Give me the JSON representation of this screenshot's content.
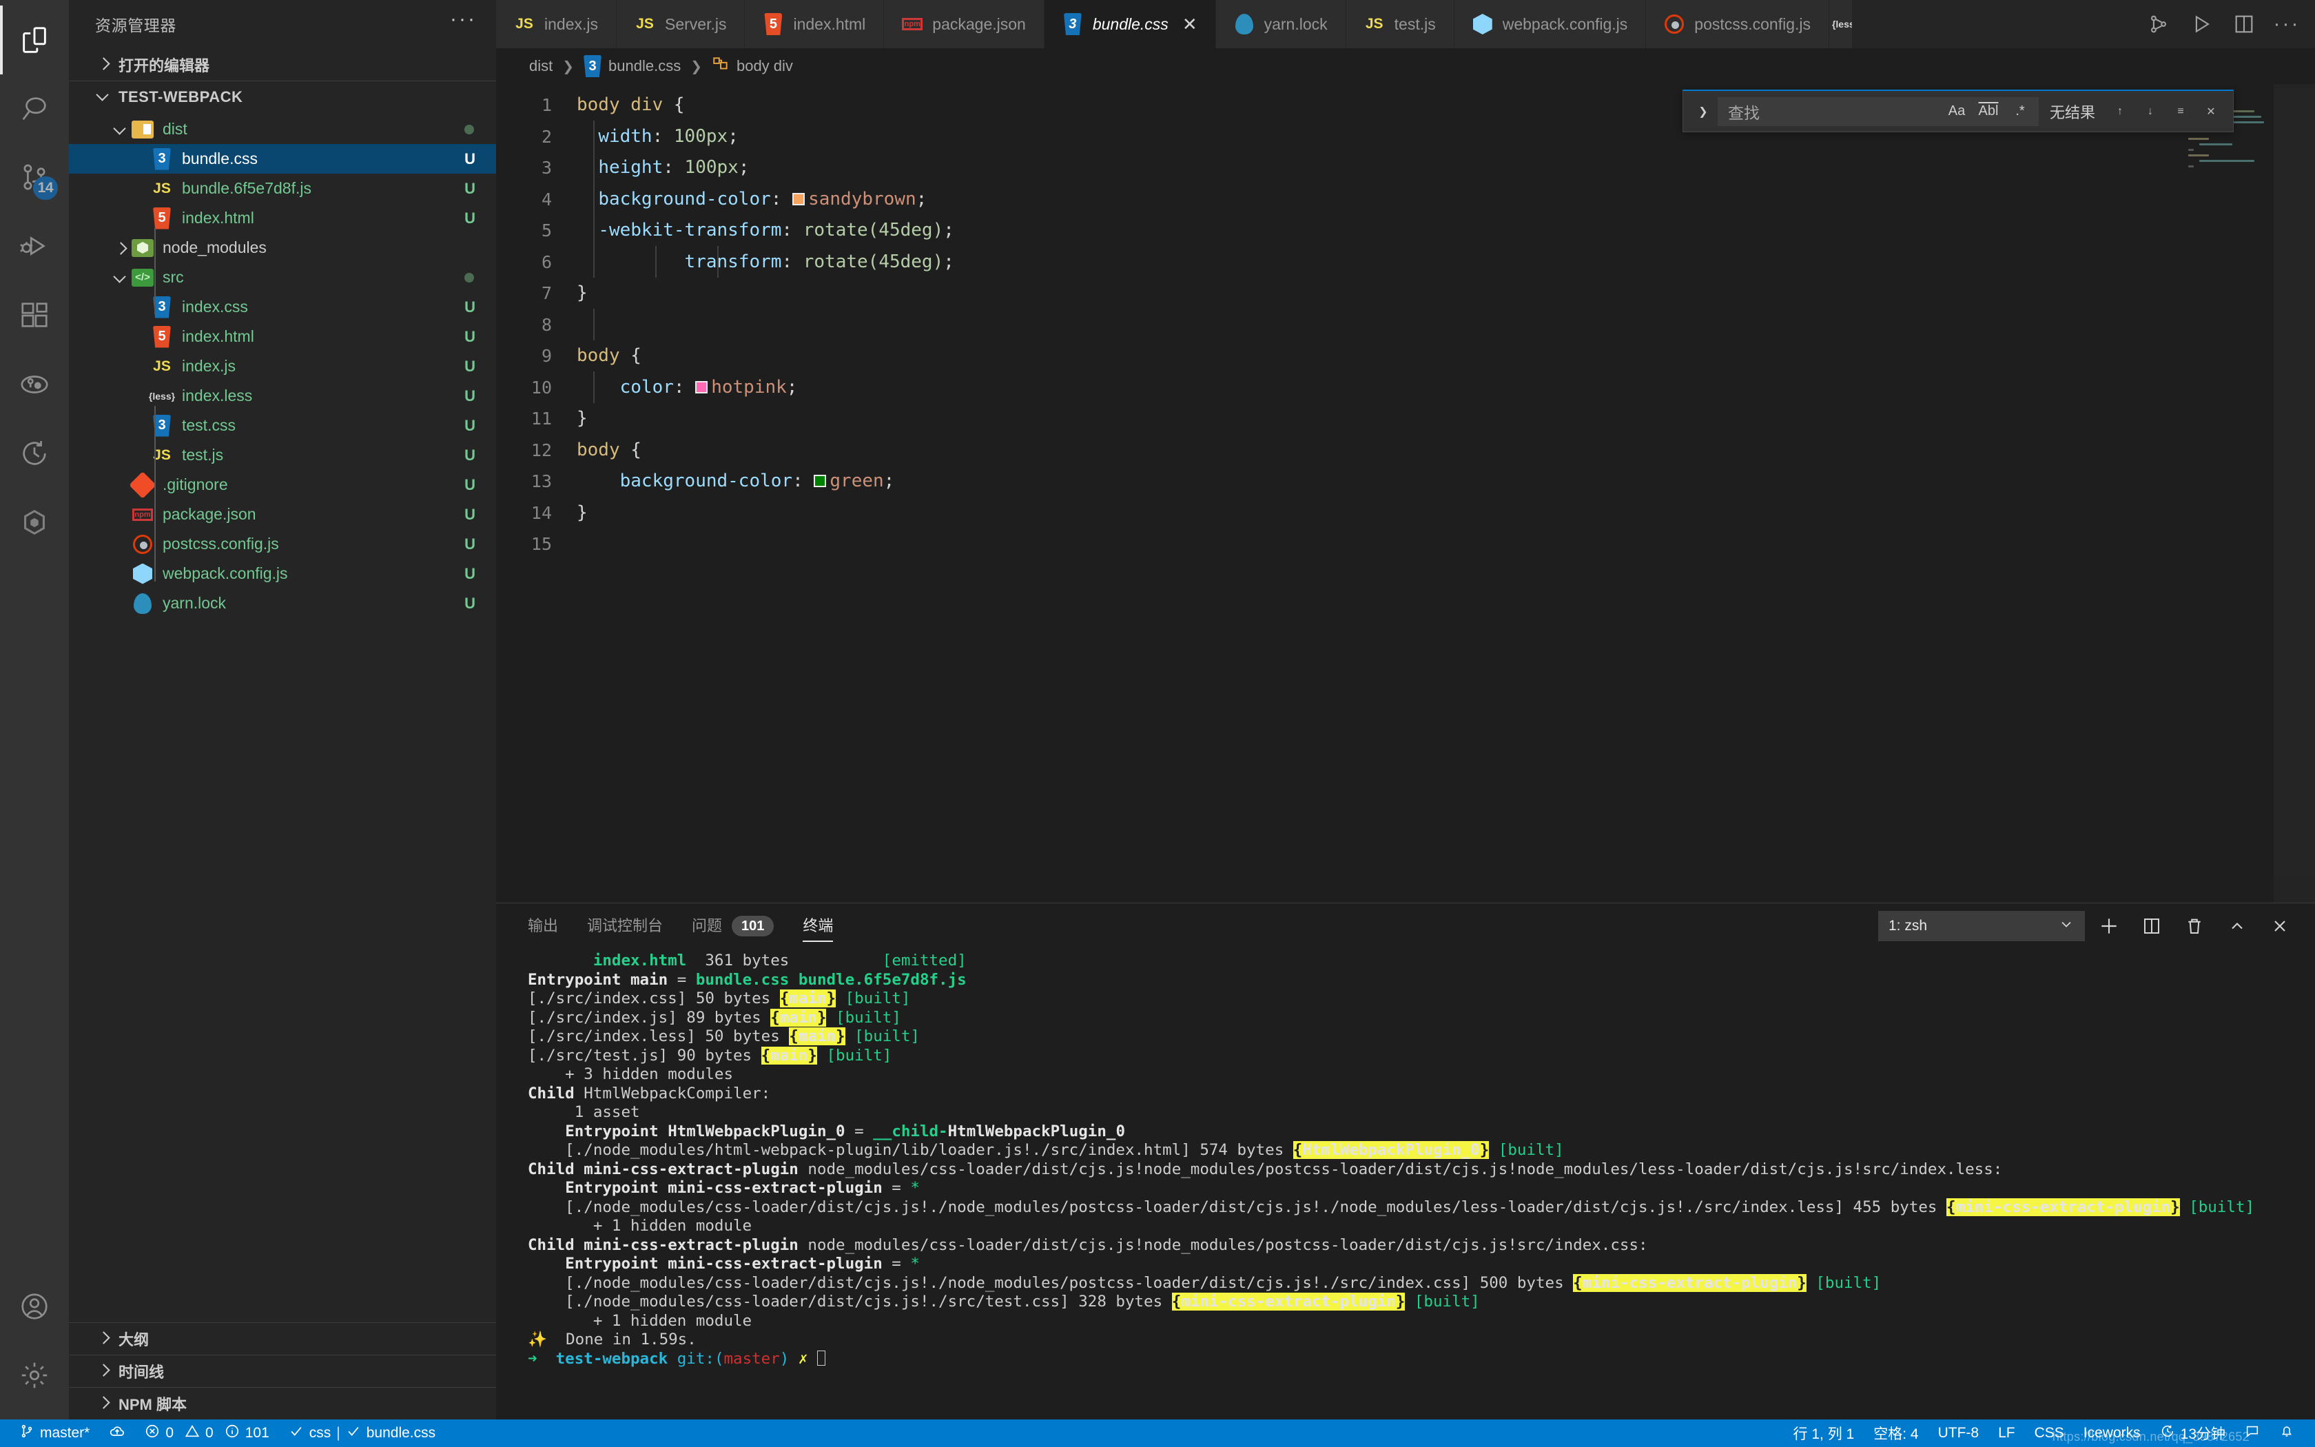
{
  "activitybar": {
    "items": [
      {
        "name": "explorer",
        "icon": "files-icon",
        "active": true,
        "badge": ""
      },
      {
        "name": "search",
        "icon": "search-icon",
        "active": false,
        "badge": ""
      },
      {
        "name": "source-control",
        "icon": "source-control-icon",
        "active": false,
        "badge": "14"
      },
      {
        "name": "run-debug",
        "icon": "run-and-debug-icon",
        "active": false,
        "badge": ""
      },
      {
        "name": "extensions",
        "icon": "extensions-icon",
        "active": false,
        "badge": ""
      },
      {
        "name": "git-graph",
        "icon": "git-graph-icon",
        "active": false,
        "badge": ""
      },
      {
        "name": "timeline",
        "icon": "history-clock-icon",
        "active": false,
        "badge": ""
      },
      {
        "name": "iceworks",
        "icon": "iceworks-hexagon-icon",
        "active": false,
        "badge": ""
      }
    ],
    "bottom": [
      {
        "name": "accounts",
        "icon": "account-icon"
      },
      {
        "name": "settings",
        "icon": "gear-icon"
      }
    ]
  },
  "sidebar": {
    "title": "资源管理器",
    "more_actions": "···",
    "open_editors_label": "打开的编辑器",
    "root_label": "TEST-WEBPACK",
    "tree": [
      {
        "label": "dist",
        "indent": 1,
        "type": "folder",
        "icon": "folder-dist-icon",
        "expanded": true,
        "status": "",
        "dot": true,
        "color": "green",
        "selected": false
      },
      {
        "label": "bundle.css",
        "indent": 2,
        "type": "file",
        "icon": "css-file-icon",
        "status": "U",
        "color": "white",
        "selected": true
      },
      {
        "label": "bundle.6f5e7d8f.js",
        "indent": 2,
        "type": "file",
        "icon": "js-file-icon",
        "status": "U",
        "color": "green",
        "selected": false
      },
      {
        "label": "index.html",
        "indent": 2,
        "type": "file",
        "icon": "html-file-icon",
        "status": "U",
        "color": "green",
        "selected": false
      },
      {
        "label": "node_modules",
        "indent": 1,
        "type": "folder",
        "icon": "folder-node-icon",
        "expanded": false,
        "status": "",
        "color": "grey",
        "selected": false
      },
      {
        "label": "src",
        "indent": 1,
        "type": "folder",
        "icon": "folder-src-icon",
        "expanded": true,
        "status": "",
        "dot": true,
        "color": "green",
        "selected": false
      },
      {
        "label": "index.css",
        "indent": 2,
        "type": "file",
        "icon": "css-file-icon",
        "status": "U",
        "color": "green",
        "selected": false
      },
      {
        "label": "index.html",
        "indent": 2,
        "type": "file",
        "icon": "html-file-icon",
        "status": "U",
        "color": "green",
        "selected": false
      },
      {
        "label": "index.js",
        "indent": 2,
        "type": "file",
        "icon": "js-file-icon",
        "status": "U",
        "color": "green",
        "selected": false
      },
      {
        "label": "index.less",
        "indent": 2,
        "type": "file",
        "icon": "less-file-icon",
        "status": "U",
        "color": "green",
        "selected": false
      },
      {
        "label": "test.css",
        "indent": 2,
        "type": "file",
        "icon": "css-file-icon",
        "status": "U",
        "color": "green",
        "selected": false
      },
      {
        "label": "test.js",
        "indent": 2,
        "type": "file",
        "icon": "js-file-icon",
        "status": "U",
        "color": "green",
        "selected": false
      },
      {
        "label": ".gitignore",
        "indent": 1,
        "type": "file",
        "icon": "git-file-icon",
        "status": "U",
        "color": "green",
        "selected": false
      },
      {
        "label": "package.json",
        "indent": 1,
        "type": "file",
        "icon": "npm-file-icon",
        "status": "U",
        "color": "green",
        "selected": false
      },
      {
        "label": "postcss.config.js",
        "indent": 1,
        "type": "file",
        "icon": "postcss-file-icon",
        "status": "U",
        "color": "green",
        "selected": false
      },
      {
        "label": "webpack.config.js",
        "indent": 1,
        "type": "file",
        "icon": "webpack-file-icon",
        "status": "U",
        "color": "green",
        "selected": false
      },
      {
        "label": "yarn.lock",
        "indent": 1,
        "type": "file",
        "icon": "yarn-file-icon",
        "status": "U",
        "color": "green",
        "selected": false
      }
    ],
    "sections": [
      {
        "label": "大纲",
        "expanded": false
      },
      {
        "label": "时间线",
        "expanded": false
      },
      {
        "label": "NPM 脚本",
        "expanded": false
      }
    ]
  },
  "tabs": [
    {
      "label": "index.js",
      "icon": "js-file-icon",
      "active": false,
      "dirty": false
    },
    {
      "label": "Server.js",
      "icon": "js-file-icon",
      "active": false,
      "dirty": false
    },
    {
      "label": "index.html",
      "icon": "html-file-icon",
      "active": false,
      "dirty": false
    },
    {
      "label": "package.json",
      "icon": "npm-file-icon",
      "active": false,
      "dirty": false
    },
    {
      "label": "bundle.css",
      "icon": "css-file-icon",
      "active": true,
      "dirty": false,
      "close": "✕"
    },
    {
      "label": "yarn.lock",
      "icon": "yarn-file-icon",
      "active": false,
      "dirty": false
    },
    {
      "label": "test.js",
      "icon": "js-file-icon",
      "active": false,
      "dirty": false
    },
    {
      "label": "webpack.config.js",
      "icon": "webpack-file-icon",
      "active": false,
      "dirty": false
    },
    {
      "label": "postcss.config.js",
      "icon": "postcss-file-icon",
      "active": false,
      "dirty": false
    }
  ],
  "tabbar_actions": [
    {
      "name": "split-in-group-icon"
    },
    {
      "name": "run-file-icon"
    },
    {
      "name": "split-editor-icon"
    },
    {
      "name": "more-actions-icon"
    }
  ],
  "breadcrumb": [
    {
      "label": "dist",
      "icon": ""
    },
    {
      "label": "bundle.css",
      "icon": "css-file-icon"
    },
    {
      "label": "body div",
      "icon": "css-rule-icon"
    }
  ],
  "editor": {
    "language": "css",
    "lines": [
      {
        "n": 1,
        "text": "body div {"
      },
      {
        "n": 2,
        "text": "  width: 100px;"
      },
      {
        "n": 3,
        "text": "  height: 100px;"
      },
      {
        "n": 4,
        "text": "  background-color: sandybrown;"
      },
      {
        "n": 5,
        "text": "  -webkit-transform: rotate(45deg);"
      },
      {
        "n": 6,
        "text": "          transform: rotate(45deg);"
      },
      {
        "n": 7,
        "text": "}"
      },
      {
        "n": 8,
        "text": ""
      },
      {
        "n": 9,
        "text": "body {"
      },
      {
        "n": 10,
        "text": "    color: hotpink;"
      },
      {
        "n": 11,
        "text": "}"
      },
      {
        "n": 12,
        "text": "body {"
      },
      {
        "n": 13,
        "text": "    background-color: green;"
      },
      {
        "n": 14,
        "text": "}"
      },
      {
        "n": 15,
        "text": ""
      }
    ],
    "color_swatches": {
      "sandybrown": "#f4a460",
      "hotpink": "#ff69b4",
      "green": "#008000"
    }
  },
  "find": {
    "placeholder": "查找",
    "value": "",
    "match_case": "Aa",
    "whole_word": "Abl",
    "regex": ".*",
    "result_text": "无结果",
    "prev": "↑",
    "next": "↓",
    "selection_only": "≡",
    "close": "✕"
  },
  "panel": {
    "tabs": [
      {
        "label": "输出",
        "active": false,
        "badge": ""
      },
      {
        "label": "调试控制台",
        "active": false,
        "badge": ""
      },
      {
        "label": "问题",
        "active": false,
        "badge": "101"
      },
      {
        "label": "终端",
        "active": true,
        "badge": ""
      }
    ],
    "terminal_select": "1: zsh",
    "actions": [
      {
        "name": "new-terminal-icon",
        "glyph": "+"
      },
      {
        "name": "split-terminal-icon",
        "glyph": "▯"
      },
      {
        "name": "kill-terminal-icon",
        "glyph": "🗑"
      },
      {
        "name": "maximize-panel-icon",
        "glyph": "^"
      },
      {
        "name": "close-panel-icon",
        "glyph": "✕"
      }
    ],
    "terminal_lines": [
      "       index.html  361 bytes          [emitted]",
      "Entrypoint main = bundle.css bundle.6f5e7d8f.js",
      "[./src/index.css] 50 bytes {main} [built]",
      "[./src/index.js] 89 bytes {main} [built]",
      "[./src/index.less] 50 bytes {main} [built]",
      "[./src/test.js] 90 bytes {main} [built]",
      "    + 3 hidden modules",
      "Child HtmlWebpackCompiler:",
      "     1 asset",
      "    Entrypoint HtmlWebpackPlugin_0 = __child-HtmlWebpackPlugin_0",
      "    [./node_modules/html-webpack-plugin/lib/loader.js!./src/index.html] 574 bytes {HtmlWebpackPlugin_0} [built]",
      "Child mini-css-extract-plugin node_modules/css-loader/dist/cjs.js!node_modules/postcss-loader/dist/cjs.js!node_modules/less-loader/dist/cjs.js!src/index.less:",
      "    Entrypoint mini-css-extract-plugin = *",
      "    [./node_modules/css-loader/dist/cjs.js!./node_modules/postcss-loader/dist/cjs.js!./node_modules/less-loader/dist/cjs.js!./src/index.less] 455 bytes {mini-css-extract-plugin} [built]",
      "       + 1 hidden module",
      "Child mini-css-extract-plugin node_modules/css-loader/dist/cjs.js!node_modules/postcss-loader/dist/cjs.js!src/index.css:",
      "    Entrypoint mini-css-extract-plugin = *",
      "    [./node_modules/css-loader/dist/cjs.js!./node_modules/postcss-loader/dist/cjs.js!./src/index.css] 500 bytes {mini-css-extract-plugin} [built]",
      "    [./node_modules/css-loader/dist/cjs.js!./src/test.css] 328 bytes {mini-css-extract-plugin} [built]",
      "       + 1 hidden module",
      "✨  Done in 1.59s.",
      "➜  test-webpack git:(master) ✗ "
    ]
  },
  "statusbar": {
    "left": [
      {
        "name": "branch",
        "icon": "source-control-icon",
        "label": "master*"
      },
      {
        "name": "sync",
        "icon": "sync-cloud-icon",
        "label": ""
      },
      {
        "name": "problems",
        "icon": "error-warning-info-icons",
        "label": "0  0  101",
        "errors": "0",
        "warnings": "0",
        "infos": "101"
      },
      {
        "name": "eslint-css",
        "icon": "check-icon",
        "label": "css"
      },
      {
        "name": "eslint-bundle",
        "icon": "check-icon",
        "label": "bundle.css"
      }
    ],
    "right": [
      {
        "name": "cursor-position",
        "label": "行 1, 列 1"
      },
      {
        "name": "indentation",
        "label": "空格: 4"
      },
      {
        "name": "encoding",
        "label": "UTF-8"
      },
      {
        "name": "eol",
        "label": "LF"
      },
      {
        "name": "language-mode",
        "label": "CSS"
      },
      {
        "name": "iceworks",
        "label": "Iceworks"
      },
      {
        "name": "time-tracker",
        "icon": "clock-icon",
        "label": "13分钟"
      },
      {
        "name": "notifications",
        "icon": "bell-icon",
        "label": ""
      },
      {
        "name": "feedback",
        "icon": "feedback-icon",
        "label": ""
      }
    ],
    "watermark": "https://blog.csdn.net/qq_39872652"
  },
  "colors": {
    "accent": "#007acc",
    "selection": "#094771",
    "editor_bg": "#1e1e1e",
    "sidebar_bg": "#252526",
    "activitybar_bg": "#333333",
    "added_green": "#73c991"
  }
}
